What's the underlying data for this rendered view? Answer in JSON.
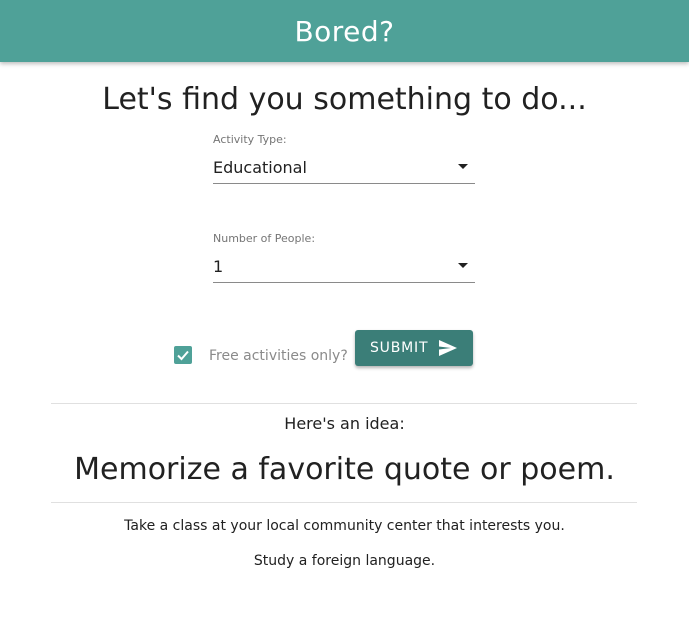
{
  "app_bar": {
    "title": "Bored?"
  },
  "headline": "Let's find you something to do...",
  "form": {
    "activity_type": {
      "label": "Activity Type:",
      "value": "Educational"
    },
    "number_of_people": {
      "label": "Number of People:",
      "value": "1"
    },
    "free_only": {
      "label": "Free activities only?",
      "checked": true
    },
    "submit_label": "SUBMIT"
  },
  "result": {
    "intro": "Here's an idea:",
    "idea": "Memorize a favorite quote or poem.",
    "suggestions": [
      "Take a class at your local community center that interests you.",
      "Study a foreign language."
    ]
  },
  "colors": {
    "app_bar": "#4fa198",
    "button": "#3b7e78",
    "checkbox": "#4fa198"
  },
  "icons": {
    "dropdown": "arrow-drop-down-icon",
    "submit": "send-icon",
    "checkbox": "check-icon"
  }
}
